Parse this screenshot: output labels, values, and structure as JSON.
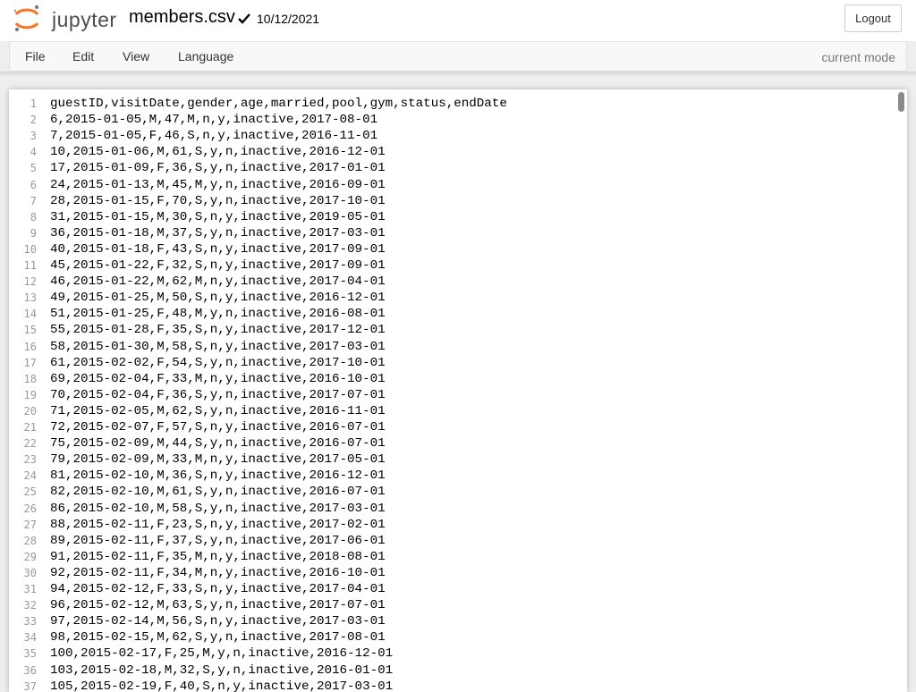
{
  "header": {
    "logo_text": "jupyter",
    "filename": "members.csv",
    "last_modified": "10/12/2021",
    "logout_label": "Logout",
    "brand_color": "#f37726"
  },
  "menubar": {
    "items": [
      "File",
      "Edit",
      "View",
      "Language"
    ],
    "mode_indicator": "current mode"
  },
  "editor": {
    "lines": [
      "guestID,visitDate,gender,age,married,pool,gym,status,endDate",
      "6,2015-01-05,M,47,M,n,y,inactive,2017-08-01",
      "7,2015-01-05,F,46,S,n,y,inactive,2016-11-01",
      "10,2015-01-06,M,61,S,y,n,inactive,2016-12-01",
      "17,2015-01-09,F,36,S,y,n,inactive,2017-01-01",
      "24,2015-01-13,M,45,M,y,n,inactive,2016-09-01",
      "28,2015-01-15,F,70,S,y,n,inactive,2017-10-01",
      "31,2015-01-15,M,30,S,n,y,inactive,2019-05-01",
      "36,2015-01-18,M,37,S,y,n,inactive,2017-03-01",
      "40,2015-01-18,F,43,S,n,y,inactive,2017-09-01",
      "45,2015-01-22,F,32,S,n,y,inactive,2017-09-01",
      "46,2015-01-22,M,62,M,n,y,inactive,2017-04-01",
      "49,2015-01-25,M,50,S,n,y,inactive,2016-12-01",
      "51,2015-01-25,F,48,M,y,n,inactive,2016-08-01",
      "55,2015-01-28,F,35,S,n,y,inactive,2017-12-01",
      "58,2015-01-30,M,58,S,n,y,inactive,2017-03-01",
      "61,2015-02-02,F,54,S,y,n,inactive,2017-10-01",
      "69,2015-02-04,F,33,M,n,y,inactive,2016-10-01",
      "70,2015-02-04,F,36,S,y,n,inactive,2017-07-01",
      "71,2015-02-05,M,62,S,y,n,inactive,2016-11-01",
      "72,2015-02-07,F,57,S,n,y,inactive,2016-07-01",
      "75,2015-02-09,M,44,S,y,n,inactive,2016-07-01",
      "79,2015-02-09,M,33,M,n,y,inactive,2017-05-01",
      "81,2015-02-10,M,36,S,n,y,inactive,2016-12-01",
      "82,2015-02-10,M,61,S,y,n,inactive,2016-07-01",
      "86,2015-02-10,M,58,S,y,n,inactive,2017-03-01",
      "88,2015-02-11,F,23,S,n,y,inactive,2017-02-01",
      "89,2015-02-11,F,37,S,y,n,inactive,2017-06-01",
      "91,2015-02-11,F,35,M,n,y,inactive,2018-08-01",
      "92,2015-02-11,F,34,M,n,y,inactive,2016-10-01",
      "94,2015-02-12,F,33,S,n,y,inactive,2017-04-01",
      "96,2015-02-12,M,63,S,y,n,inactive,2017-07-01",
      "97,2015-02-14,M,56,S,n,y,inactive,2017-03-01",
      "98,2015-02-15,M,62,S,y,n,inactive,2017-08-01",
      "100,2015-02-17,F,25,M,y,n,inactive,2016-12-01",
      "103,2015-02-18,M,32,S,y,n,inactive,2016-01-01",
      "105,2015-02-19,F,40,S,n,y,inactive,2017-03-01"
    ]
  }
}
